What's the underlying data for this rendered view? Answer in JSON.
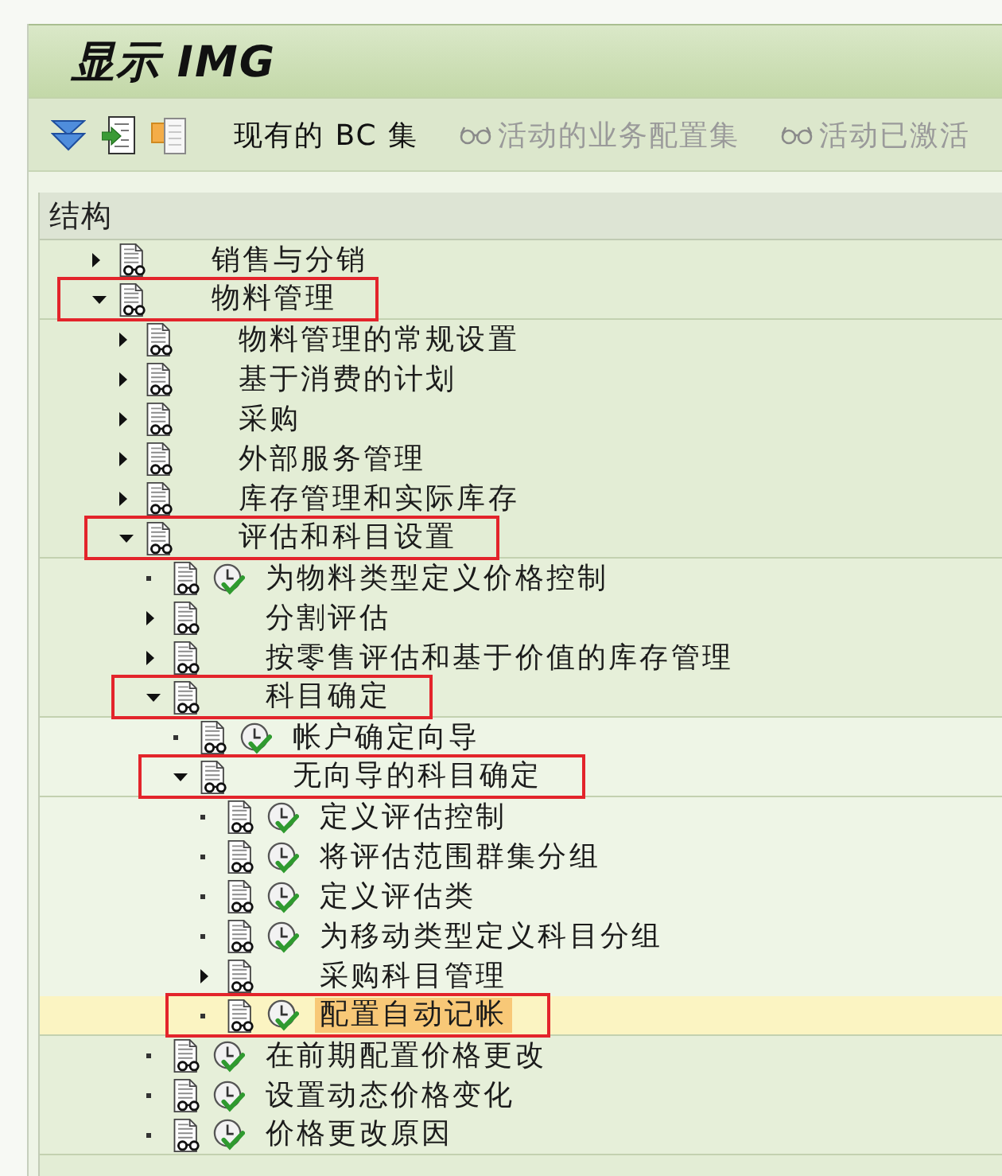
{
  "window": {
    "title": "显示 IMG"
  },
  "toolbar": {
    "items": [
      {
        "kind": "text",
        "label": "现有的 BC 集",
        "disabled": false
      },
      {
        "kind": "icon-text",
        "label": "活动的业务配置集",
        "disabled": true
      },
      {
        "kind": "icon-text",
        "label": "活动已激活",
        "disabled": true
      }
    ]
  },
  "structure": {
    "header": "结构",
    "tree": [
      {
        "label": "销售与分销",
        "kind": "node",
        "expanded": false,
        "selected": false,
        "annotated": false
      },
      {
        "label": "物料管理",
        "kind": "node",
        "expanded": true,
        "selected": false,
        "annotated": true,
        "children": [
          {
            "label": "物料管理的常规设置",
            "kind": "node",
            "expanded": false,
            "selected": false,
            "annotated": false
          },
          {
            "label": "基于消费的计划",
            "kind": "node",
            "expanded": false,
            "selected": false,
            "annotated": false
          },
          {
            "label": "采购",
            "kind": "node",
            "expanded": false,
            "selected": false,
            "annotated": false
          },
          {
            "label": "外部服务管理",
            "kind": "node",
            "expanded": false,
            "selected": false,
            "annotated": false
          },
          {
            "label": "库存管理和实际库存",
            "kind": "node",
            "expanded": false,
            "selected": false,
            "annotated": false
          },
          {
            "label": "评估和科目设置",
            "kind": "node",
            "expanded": true,
            "selected": false,
            "annotated": true,
            "children": [
              {
                "label": "为物料类型定义价格控制",
                "kind": "activity",
                "selected": false,
                "annotated": false
              },
              {
                "label": "分割评估",
                "kind": "node",
                "expanded": false,
                "selected": false,
                "annotated": false
              },
              {
                "label": "按零售评估和基于价值的库存管理",
                "kind": "node",
                "expanded": false,
                "selected": false,
                "annotated": false
              },
              {
                "label": "科目确定",
                "kind": "node",
                "expanded": true,
                "selected": false,
                "annotated": true,
                "children": [
                  {
                    "label": "帐户确定向导",
                    "kind": "activity",
                    "selected": false,
                    "annotated": false
                  },
                  {
                    "label": "无向导的科目确定",
                    "kind": "node",
                    "expanded": true,
                    "selected": false,
                    "annotated": true,
                    "children": [
                      {
                        "label": "定义评估控制",
                        "kind": "activity",
                        "selected": false,
                        "annotated": false
                      },
                      {
                        "label": "将评估范围群集分组",
                        "kind": "activity",
                        "selected": false,
                        "annotated": false
                      },
                      {
                        "label": "定义评估类",
                        "kind": "activity",
                        "selected": false,
                        "annotated": false
                      },
                      {
                        "label": "为移动类型定义科目分组",
                        "kind": "activity",
                        "selected": false,
                        "annotated": false
                      },
                      {
                        "label": "采购科目管理",
                        "kind": "node",
                        "expanded": false,
                        "selected": false,
                        "annotated": false
                      },
                      {
                        "label": "配置自动记帐",
                        "kind": "activity",
                        "selected": true,
                        "annotated": true
                      }
                    ]
                  }
                ]
              },
              {
                "label": "在前期配置价格更改",
                "kind": "activity",
                "selected": false,
                "annotated": false
              },
              {
                "label": "设置动态价格变化",
                "kind": "activity",
                "selected": false,
                "annotated": false
              },
              {
                "label": "价格更改原因",
                "kind": "activity",
                "selected": false,
                "annotated": false
              }
            ]
          }
        ]
      }
    ]
  }
}
